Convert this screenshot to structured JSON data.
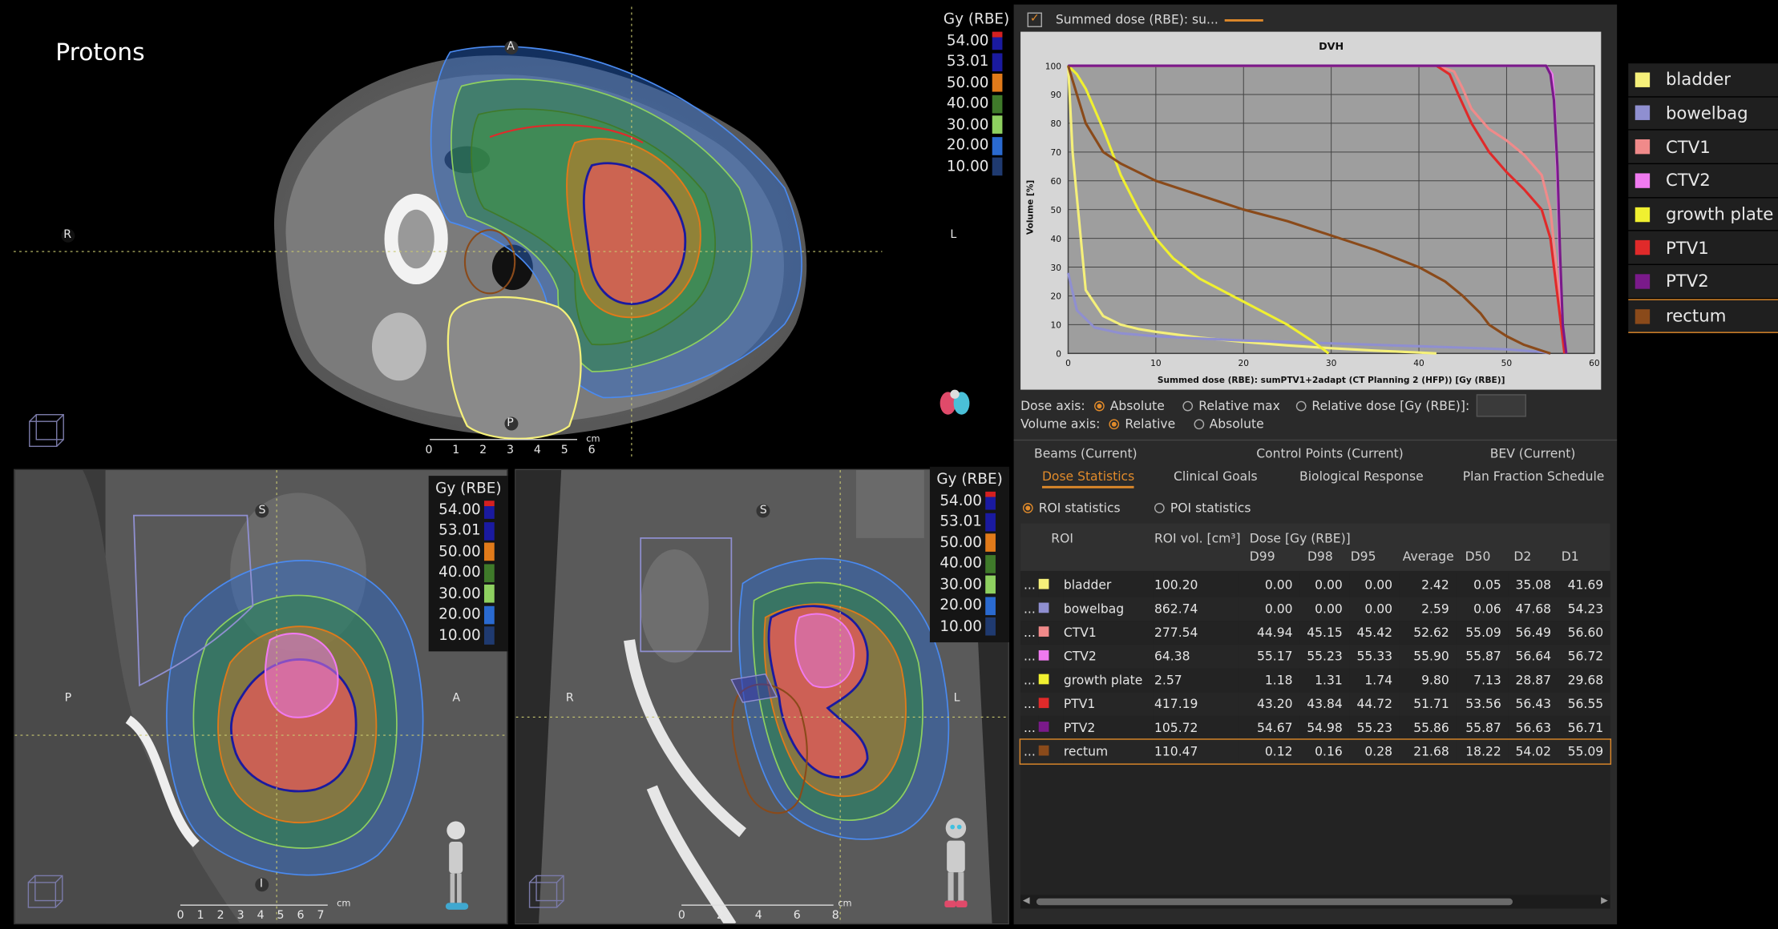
{
  "axial_view": {
    "title": "Protons",
    "orient": {
      "top": "A",
      "left": "R",
      "right": "L",
      "bottom": "P"
    },
    "scale_ticks": [
      "0",
      "1",
      "2",
      "3",
      "4",
      "5",
      "6"
    ],
    "scale_unit": "cm"
  },
  "sagittal_view": {
    "orient": {
      "top": "S",
      "left": "P",
      "right": "A",
      "bottom": "I"
    },
    "scale_ticks": [
      "0",
      "1",
      "2",
      "3",
      "4",
      "5",
      "6",
      "7"
    ],
    "scale_unit": "cm"
  },
  "coronal_view": {
    "orient": {
      "top": "S",
      "left": "R",
      "right": "L"
    },
    "scale_ticks": [
      "0",
      "2",
      "4",
      "6",
      "8"
    ],
    "scale_unit": "cm"
  },
  "dose_legend": {
    "title": "Gy (RBE)",
    "levels": [
      {
        "value": "54.00",
        "color": "#d42020"
      },
      {
        "value": "53.01",
        "color": "#1a1aa0"
      },
      {
        "value": "50.00",
        "color": "#e07a1a"
      },
      {
        "value": "40.00",
        "color": "#3f7a2a"
      },
      {
        "value": "30.00",
        "color": "#8ed060"
      },
      {
        "value": "20.00",
        "color": "#2a6ad0"
      },
      {
        "value": "10.00",
        "color": "#1f3a70"
      }
    ]
  },
  "panel": {
    "summed_dose_label": "Summed dose (RBE): su...",
    "dose_axis": {
      "label": "Dose axis:",
      "options": [
        "Absolute",
        "Relative max",
        "Relative dose [Gy (RBE)]:"
      ],
      "selected": 0
    },
    "volume_axis": {
      "label": "Volume axis:",
      "options": [
        "Relative",
        "Absolute"
      ],
      "selected": 0
    },
    "tabs_row1": [
      "Beams (Current)",
      "Control Points (Current)",
      "BEV (Current)"
    ],
    "tabs_row2": [
      "Dose Statistics",
      "Clinical Goals",
      "Biological Response",
      "Plan Fraction Schedule"
    ],
    "active_tab": "Dose Statistics",
    "stat_modes": [
      "ROI statistics",
      "POI statistics"
    ],
    "table": {
      "headers": {
        "roi": "ROI",
        "vol": "ROI vol. [cm³]",
        "dose_group": "Dose [Gy (RBE)]"
      },
      "dose_cols": [
        "D99",
        "D98",
        "D95",
        "Average",
        "D50",
        "D2",
        "D1"
      ],
      "rows": [
        {
          "dots": "...",
          "color": "#f5f07a",
          "roi": "bladder",
          "vol": "100.20",
          "d": [
            "0.00",
            "0.00",
            "0.00",
            "2.42",
            "0.05",
            "35.08",
            "41.69"
          ]
        },
        {
          "dots": "...",
          "color": "#8f8fd0",
          "roi": "bowelbag",
          "vol": "862.74",
          "d": [
            "0.00",
            "0.00",
            "0.00",
            "2.59",
            "0.06",
            "47.68",
            "54.23"
          ]
        },
        {
          "dots": "...",
          "color": "#f08a8a",
          "roi": "CTV1",
          "vol": "277.54",
          "d": [
            "44.94",
            "45.15",
            "45.42",
            "52.62",
            "55.09",
            "56.49",
            "56.60"
          ]
        },
        {
          "dots": "...",
          "color": "#f07af0",
          "roi": "CTV2",
          "vol": "64.38",
          "d": [
            "55.17",
            "55.23",
            "55.33",
            "55.90",
            "55.87",
            "56.64",
            "56.72"
          ]
        },
        {
          "dots": "...",
          "color": "#f0f030",
          "roi": "growth plate",
          "vol": "2.57",
          "d": [
            "1.18",
            "1.31",
            "1.74",
            "9.80",
            "7.13",
            "28.87",
            "29.68"
          ]
        },
        {
          "dots": "...",
          "color": "#e02a2a",
          "roi": "PTV1",
          "vol": "417.19",
          "d": [
            "43.20",
            "43.84",
            "44.72",
            "51.71",
            "53.56",
            "56.43",
            "56.55"
          ]
        },
        {
          "dots": "...",
          "color": "#7a1a8a",
          "roi": "PTV2",
          "vol": "105.72",
          "d": [
            "54.67",
            "54.98",
            "55.23",
            "55.86",
            "55.87",
            "56.63",
            "56.71"
          ]
        },
        {
          "dots": "...",
          "color": "#8a4a1a",
          "roi": "rectum",
          "vol": "110.47",
          "d": [
            "0.12",
            "0.16",
            "0.28",
            "21.68",
            "18.22",
            "54.02",
            "55.09"
          ]
        }
      ]
    }
  },
  "roi_legend": [
    {
      "name": "bladder",
      "color": "#f5f07a"
    },
    {
      "name": "bowelbag",
      "color": "#8f8fd0"
    },
    {
      "name": "CTV1",
      "color": "#f08a8a"
    },
    {
      "name": "CTV2",
      "color": "#f07af0"
    },
    {
      "name": "growth plate",
      "color": "#f0f030"
    },
    {
      "name": "PTV1",
      "color": "#e02a2a"
    },
    {
      "name": "PTV2",
      "color": "#7a1a8a"
    },
    {
      "name": "rectum",
      "color": "#8a4a1a"
    }
  ],
  "chart_data": {
    "type": "line",
    "title": "DVH",
    "xlabel": "Summed dose (RBE): sumPTV1+2adapt (CT Planning 2 (HFP)) [Gy (RBE)]",
    "ylabel": "Volume [%]",
    "xlim": [
      0,
      60
    ],
    "ylim": [
      0,
      100
    ],
    "xticks": [
      0,
      10,
      20,
      30,
      40,
      50,
      60
    ],
    "yticks": [
      0,
      10,
      20,
      30,
      40,
      50,
      60,
      70,
      80,
      90,
      100
    ],
    "grid": true,
    "series": [
      {
        "name": "bladder",
        "color": "#f5f07a",
        "x": [
          0,
          0.5,
          2,
          4,
          6,
          8,
          10,
          15,
          20,
          25,
          30,
          35,
          40,
          42
        ],
        "y": [
          100,
          70,
          22,
          13,
          10,
          8.5,
          7.5,
          5.5,
          4,
          2.8,
          1.8,
          1,
          0.3,
          0
        ]
      },
      {
        "name": "bowelbag",
        "color": "#8f8fd0",
        "x": [
          0,
          1,
          3,
          6,
          10,
          15,
          20,
          30,
          40,
          45,
          50,
          54,
          55
        ],
        "y": [
          28,
          15,
          9,
          7,
          6,
          5.2,
          4.5,
          3.5,
          2.5,
          2,
          1.4,
          0.5,
          0
        ]
      },
      {
        "name": "CTV1",
        "color": "#f08a8a",
        "x": [
          0,
          42,
          44,
          45,
          46,
          48,
          50,
          52,
          54,
          55,
          56,
          56.6
        ],
        "y": [
          100,
          100,
          98,
          92,
          85,
          78,
          74,
          69,
          62,
          50,
          20,
          0
        ]
      },
      {
        "name": "CTV2",
        "color": "#f07af0",
        "x": [
          0,
          54.5,
          55.2,
          55.5,
          55.8,
          56.1,
          56.4,
          56.8
        ],
        "y": [
          100,
          100,
          97,
          85,
          60,
          30,
          8,
          0
        ]
      },
      {
        "name": "growth plate",
        "color": "#f0f030",
        "x": [
          0,
          1,
          2,
          3,
          4,
          5,
          6,
          8,
          10,
          12,
          15,
          20,
          25,
          28,
          29.7
        ],
        "y": [
          100,
          97,
          92,
          85,
          78,
          70,
          62,
          50,
          40,
          33,
          26,
          18,
          10,
          4,
          0
        ]
      },
      {
        "name": "PTV1",
        "color": "#e02a2a",
        "x": [
          0,
          42,
          43.5,
          44.5,
          46,
          48,
          50,
          52,
          54,
          55,
          56,
          56.6
        ],
        "y": [
          100,
          100,
          97,
          90,
          80,
          70,
          63,
          57,
          50,
          40,
          15,
          0
        ]
      },
      {
        "name": "PTV2",
        "color": "#7a1a8a",
        "x": [
          0,
          54.5,
          55,
          55.4,
          55.8,
          56.1,
          56.4,
          56.8
        ],
        "y": [
          100,
          100,
          97,
          88,
          65,
          35,
          10,
          0
        ]
      },
      {
        "name": "rectum",
        "color": "#8a4a1a",
        "x": [
          0,
          1,
          2,
          4,
          6,
          10,
          15,
          20,
          25,
          30,
          35,
          40,
          43,
          45,
          47,
          48,
          50,
          52,
          54,
          55
        ],
        "y": [
          100,
          90,
          80,
          70,
          66,
          60,
          55,
          50,
          46,
          41,
          36,
          30,
          25,
          20,
          14,
          10,
          6,
          3,
          1,
          0
        ]
      }
    ]
  }
}
